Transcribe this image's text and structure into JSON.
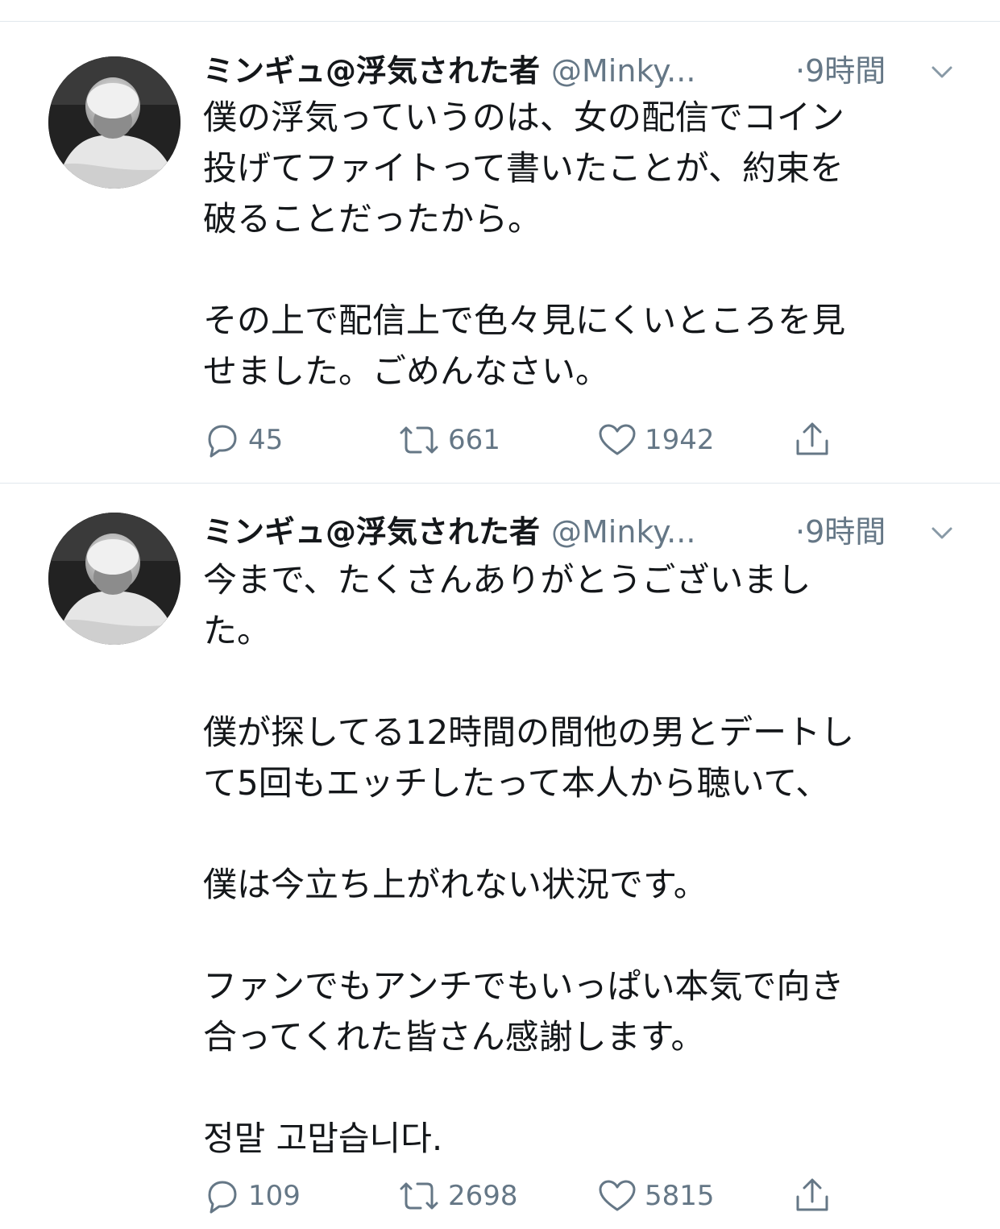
{
  "tweets": [
    {
      "display_name": "ミンギュ@浮気された者",
      "handle": "@Minky...",
      "time": "·9時間",
      "paragraphs": [
        "僕の浮気っていうのは、女の配信でコイン\n投げてファイトって書いたことが、約束を\n破ることだったから。",
        "その上で配信上で色々見にくいところを見\nせました。ごめんなさい。"
      ],
      "replies": "45",
      "retweets": "661",
      "likes": "1942"
    },
    {
      "display_name": "ミンギュ@浮気された者",
      "handle": "@Minky...",
      "time": "·9時間",
      "paragraphs": [
        "今まで、たくさんありがとうございまし\nた。",
        "僕が探してる12時間の間他の男とデートし\nて5回もエッチしたって本人から聴いて、",
        "僕は今立ち上がれない状況です。",
        "ファンでもアンチでもいっぱい本気で向き\n合ってくれた皆さん感謝します。",
        "정말 고맙습니다."
      ],
      "replies": "109",
      "retweets": "2698",
      "likes": "5815"
    }
  ],
  "icons": {
    "reply": "reply-icon",
    "retweet": "retweet-icon",
    "like": "heart-icon",
    "share": "share-icon",
    "menu": "chevron-down-icon"
  },
  "colors": {
    "text": "#14171a",
    "secondary": "#657786",
    "divider": "#e1e8ed"
  }
}
